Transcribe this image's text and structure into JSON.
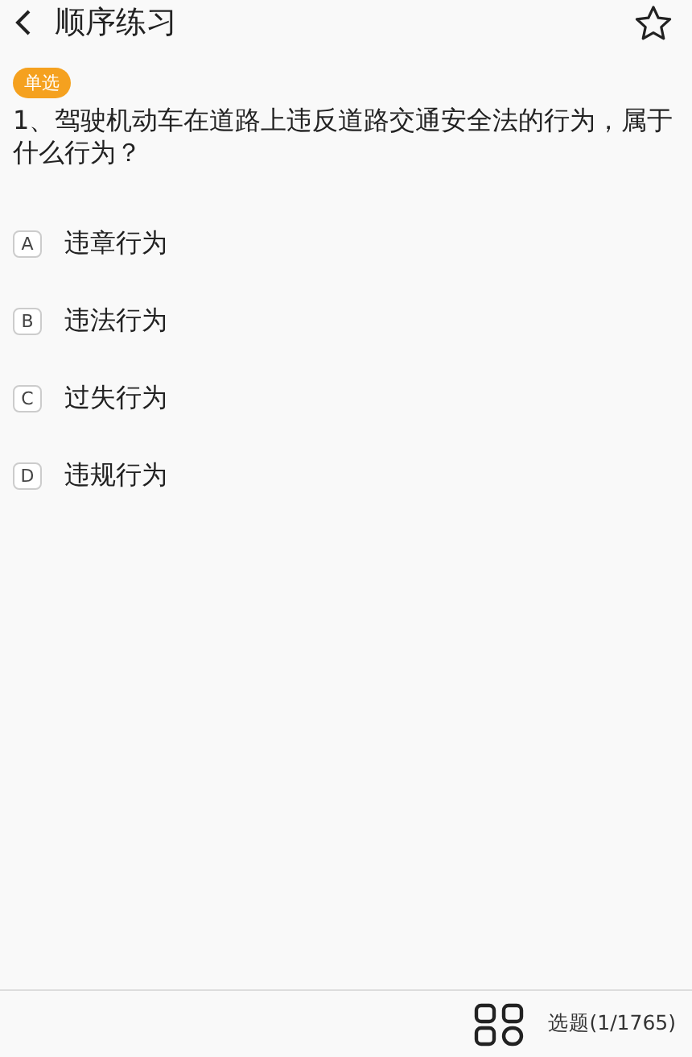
{
  "header": {
    "title": "顺序练习",
    "favorited": false
  },
  "question": {
    "type_badge": "单选",
    "text": "1、驾驶机动车在道路上违反道路交通安全法的行为，属于什么行为？"
  },
  "options": [
    {
      "letter": "A",
      "text": "违章行为",
      "selected": false
    },
    {
      "letter": "B",
      "text": "违法行为",
      "selected": false
    },
    {
      "letter": "C",
      "text": "过失行为",
      "selected": false
    },
    {
      "letter": "D",
      "text": "违规行为",
      "selected": false
    }
  ],
  "footer": {
    "progress": "选题(1/1765)"
  }
}
